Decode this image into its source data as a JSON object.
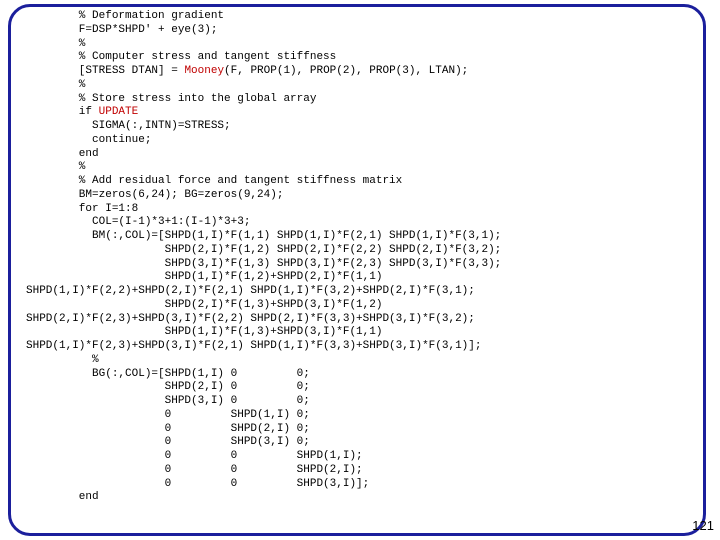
{
  "code": {
    "l1": "        % Deformation gradient",
    "l2": "        F=DSP*SHPD' + eye(3);",
    "l3": "        %",
    "l4": "        % Computer stress and tangent stiffness",
    "l5a": "        [STRESS DTAN] = ",
    "l5b": "Mooney",
    "l5c": "(F, PROP(1), PROP(2), PROP(3), LTAN);",
    "l6": "        %",
    "l7": "        % Store stress into the global array",
    "l8a": "        if ",
    "l8b": "UPDATE",
    "l9": "          SIGMA(:,INTN)=STRESS;",
    "l10": "          continue;",
    "l11": "        end",
    "l12": "        %",
    "l13": "        % Add residual force and tangent stiffness matrix",
    "l14": "        BM=zeros(6,24); BG=zeros(9,24);",
    "l15": "        for I=1:8",
    "l16": "          COL=(I-1)*3+1:(I-1)*3+3;",
    "l17": "          BM(:,COL)=[SHPD(1,I)*F(1,1) SHPD(1,I)*F(2,1) SHPD(1,I)*F(3,1);",
    "l18": "                     SHPD(2,I)*F(1,2) SHPD(2,I)*F(2,2) SHPD(2,I)*F(3,2);",
    "l19": "                     SHPD(3,I)*F(1,3) SHPD(3,I)*F(2,3) SHPD(3,I)*F(3,3);",
    "l20": "                     SHPD(1,I)*F(1,2)+SHPD(2,I)*F(1,1)",
    "l21": "SHPD(1,I)*F(2,2)+SHPD(2,I)*F(2,1) SHPD(1,I)*F(3,2)+SHPD(2,I)*F(3,1);",
    "l22": "                     SHPD(2,I)*F(1,3)+SHPD(3,I)*F(1,2)",
    "l23": "SHPD(2,I)*F(2,3)+SHPD(3,I)*F(2,2) SHPD(2,I)*F(3,3)+SHPD(3,I)*F(3,2);",
    "l24": "                     SHPD(1,I)*F(1,3)+SHPD(3,I)*F(1,1)",
    "l25": "SHPD(1,I)*F(2,3)+SHPD(3,I)*F(2,1) SHPD(1,I)*F(3,3)+SHPD(3,I)*F(3,1)];",
    "l26": "          %",
    "l27": "          BG(:,COL)=[SHPD(1,I) 0         0;",
    "l28": "                     SHPD(2,I) 0         0;",
    "l29": "                     SHPD(3,I) 0         0;",
    "l30": "                     0         SHPD(1,I) 0;",
    "l31": "                     0         SHPD(2,I) 0;",
    "l32": "                     0         SHPD(3,I) 0;",
    "l33": "                     0         0         SHPD(1,I);",
    "l34": "                     0         0         SHPD(2,I);",
    "l35": "                     0         0         SHPD(3,I)];",
    "l36": "        end"
  },
  "pagenum": "121"
}
